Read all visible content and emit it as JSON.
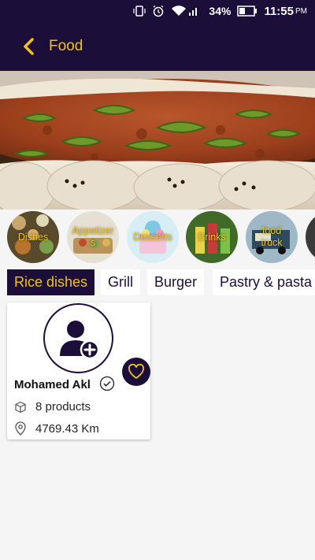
{
  "status_bar": {
    "battery": "34%",
    "time": "11:55",
    "ampm": "PM"
  },
  "header": {
    "title": "Food"
  },
  "categories": [
    {
      "label": "Dishes"
    },
    {
      "label": "Appetizers"
    },
    {
      "label": "Desserts"
    },
    {
      "label": "Drinks"
    },
    {
      "label": "food truck"
    }
  ],
  "tabs": [
    {
      "label": "Rice dishes",
      "active": true
    },
    {
      "label": "Grill"
    },
    {
      "label": "Burger"
    },
    {
      "label": "Pastry & pasta"
    }
  ],
  "vendor": {
    "name": "Mohamed Akl",
    "products": "8 products",
    "distance": "4769.43 Km"
  },
  "colors": {
    "primary": "#1b0f3a",
    "accent": "#f2c21a",
    "background": "#f5f5f5"
  }
}
